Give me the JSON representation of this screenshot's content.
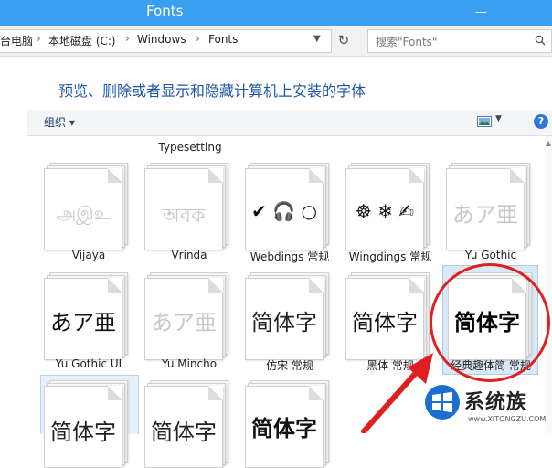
{
  "window": {
    "title": "Fonts",
    "minimize": "—"
  },
  "address": {
    "crumbs": [
      "台电脑",
      "本地磁盘 (C:)",
      "Windows",
      "Fonts"
    ],
    "separator": "›",
    "search_placeholder": "搜索\"Fonts\""
  },
  "header": {
    "title": "预览、删除或者显示和隐藏计算机上安装的字体"
  },
  "toolbar": {
    "organize": "组织 ▾",
    "help": "?"
  },
  "colors": {
    "titlebar": "#3b9ff0",
    "link_blue": "#1e56a6",
    "annotation_red": "#e02020"
  },
  "fonts": {
    "partial_label": "Typesetting",
    "row1": [
      {
        "name": "Vijaya",
        "sample": "அஇஉ",
        "faded": true
      },
      {
        "name": "Vrinda",
        "sample": "অবক",
        "faded": true
      },
      {
        "name": "Webdings 常规",
        "sample": "✔ 🎧 ○",
        "faded": false
      },
      {
        "name": "Wingdings 常规",
        "sample": "☸ ❄ ✍",
        "faded": false
      },
      {
        "name": "Yu Gothic",
        "sample": "あア亜",
        "faded": true
      }
    ],
    "row2": [
      {
        "name": "Yu Gothic UI",
        "sample": "あア亜",
        "faded": false
      },
      {
        "name": "Yu Mincho",
        "sample": "あア亜",
        "faded": true
      },
      {
        "name": "仿宋 常规",
        "sample": "简体字",
        "faded": false
      },
      {
        "name": "黑体 常规",
        "sample": "简体字",
        "faded": false
      },
      {
        "name": "经典趣体简 常规",
        "sample": "简体字",
        "faded": false
      }
    ],
    "row3": [
      {
        "sample": "简体字"
      },
      {
        "sample": "简体字"
      },
      {
        "sample": "简体字"
      }
    ]
  },
  "watermark": {
    "name": "系统族",
    "url": "www.XITONGZU.COM"
  }
}
